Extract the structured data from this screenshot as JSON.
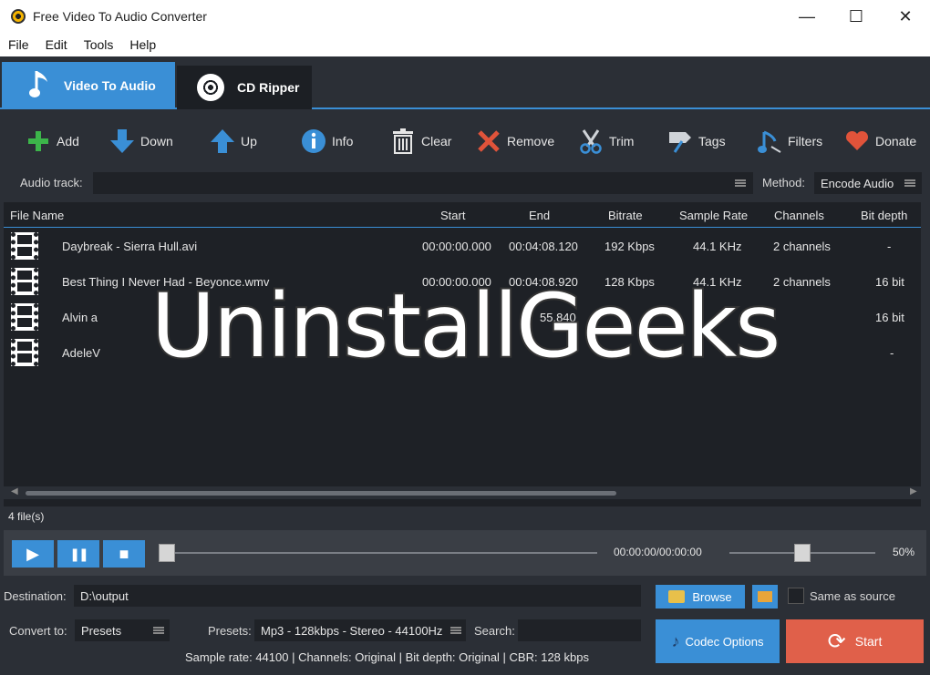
{
  "window": {
    "title": "Free Video To Audio Converter",
    "minimize": "—",
    "maximize": "☐",
    "close": "✕"
  },
  "menu": [
    "File",
    "Edit",
    "Tools",
    "Help"
  ],
  "tabs": [
    {
      "label": "Video To Audio",
      "icon": "music-note-icon",
      "active": true
    },
    {
      "label": "CD Ripper",
      "icon": "cd-icon",
      "active": false
    }
  ],
  "toolbar": {
    "add": "Add",
    "down": "Down",
    "up": "Up",
    "info": "Info",
    "clear": "Clear",
    "remove": "Remove",
    "trim": "Trim",
    "tags": "Tags",
    "filters": "Filters",
    "donate": "Donate"
  },
  "audio_track": {
    "label": "Audio track:",
    "value": ""
  },
  "method": {
    "label": "Method:",
    "value": "Encode Audio"
  },
  "table": {
    "headers": {
      "name": "File Name",
      "start": "Start",
      "end": "End",
      "bitrate": "Bitrate",
      "sample_rate": "Sample Rate",
      "channels": "Channels",
      "bit_depth": "Bit depth"
    },
    "rows": [
      {
        "name": "Daybreak - Sierra Hull.avi",
        "start": "00:00:00.000",
        "end": "00:04:08.120",
        "bitrate": "192 Kbps",
        "sample_rate": "44.1 KHz",
        "channels": "2 channels",
        "bit_depth": "-"
      },
      {
        "name": "Best Thing I Never Had - Beyonce.wmv",
        "start": "00:00:00.000",
        "end": "00:04:08.920",
        "bitrate": "128 Kbps",
        "sample_rate": "44.1 KHz",
        "channels": "2 channels",
        "bit_depth": "16 bit"
      },
      {
        "name": "Alvin a",
        "start": "",
        "end": "55.840",
        "bitrate": "",
        "sample_rate": "",
        "channels": "",
        "bit_depth": "16 bit"
      },
      {
        "name": "AdeleV",
        "start": "",
        "end": "",
        "bitrate": "",
        "sample_rate": "",
        "channels": "",
        "bit_depth": "-"
      }
    ]
  },
  "file_count": "4 file(s)",
  "player": {
    "play": "▶",
    "pause": "❚❚",
    "stop": "■",
    "time": "00:00:00/00:00:00",
    "volume": "50%",
    "volume_fraction": 0.5
  },
  "destination": {
    "label": "Destination:",
    "value": "D:\\output"
  },
  "browse": "Browse",
  "same_as_source": "Same as source",
  "convert_to": {
    "label": "Convert to:",
    "value": "Presets"
  },
  "presets": {
    "label": "Presets:",
    "value": "Mp3 - 128kbps - Stereo - 44100Hz"
  },
  "search": {
    "label": "Search:",
    "value": ""
  },
  "codec_options": "Codec Options",
  "start": "Start",
  "status": "Sample rate: 44100 | Channels: Original | Bit depth: Original | CBR: 128 kbps",
  "watermark": "UninstallGeeks"
}
